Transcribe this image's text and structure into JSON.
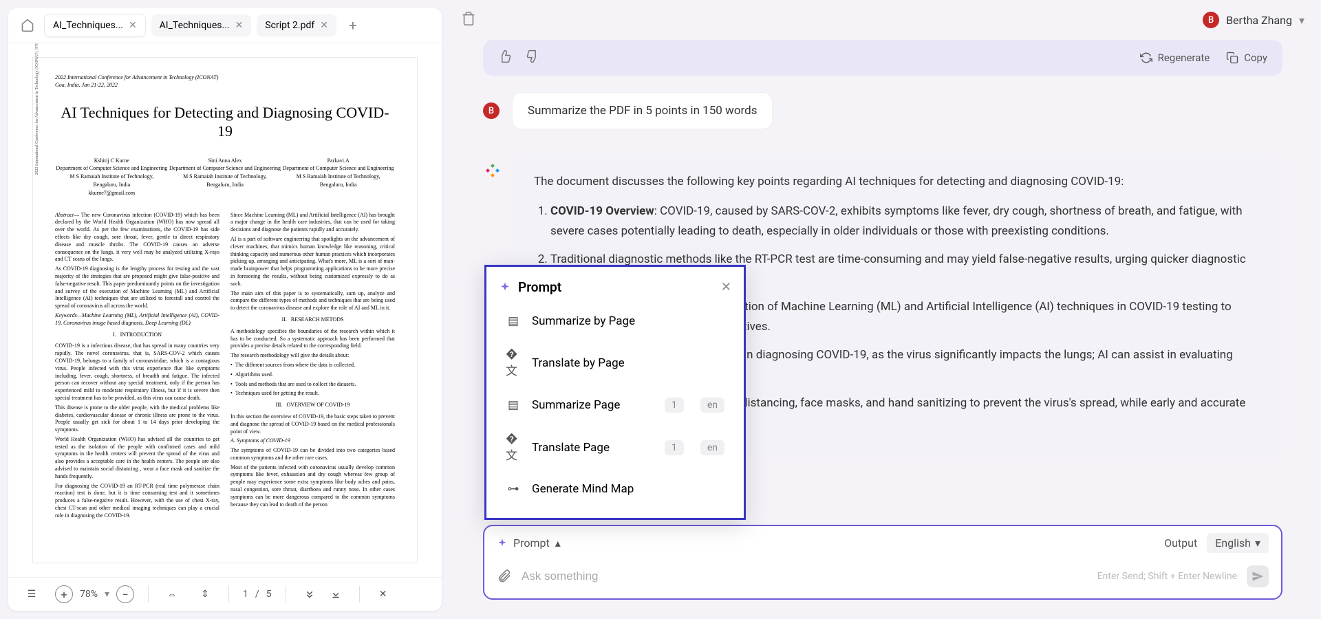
{
  "tabs": [
    {
      "label": "AI_Techniques...",
      "active": true
    },
    {
      "label": "AI_Techniques...",
      "active": false
    },
    {
      "label": "Script 2.pdf",
      "active": false
    }
  ],
  "doc": {
    "conference": "2022 International Conference for Advancement in Technology (ICONAT)\nGoa, India. Jan 21-22, 2022",
    "title": "AI Techniques for Detecting and Diagnosing COVID-19",
    "authors": [
      {
        "name": "Kshitij C Kurne",
        "dept": "Department of Computer Science and Engineering",
        "inst": "M S Ramaiah Institute of Technology,",
        "city": "Bengaluru, India",
        "email": "kkurne7@gmail.com"
      },
      {
        "name": "Sini Anna Alex",
        "dept": "Department of Computer Science and Engineering",
        "inst": "M S Ramaiah Institute of Technology,",
        "city": "Bengaluru, India",
        "email": ""
      },
      {
        "name": "Parkavi.A",
        "dept": "Department of Computer Science and Engineering",
        "inst": "M S Ramaiah Institute of Technology,",
        "city": "Bengaluru, India",
        "email": ""
      }
    ],
    "sidebar_text": "2022 International Conference for Advancement in Technology (ICONAT) | 978-1-6654-2577-3/22/$31.00 ©2022 IEEE | DOI: 10.1109/ICONAT53423.2022.9725935"
  },
  "toolbar": {
    "zoom": "78%",
    "page_current": "1",
    "page_total": "5"
  },
  "user": {
    "name": "Bertha Zhang",
    "initial": "B"
  },
  "actions": {
    "regenerate": "Regenerate",
    "copy": "Copy"
  },
  "user_message": "Summarize the PDF in 5 points in 150 words",
  "ai_response": {
    "intro": "The document discusses the following key points regarding AI techniques for detecting and diagnosing COVID-19:",
    "points": [
      {
        "title": "COVID-19 Overview",
        "body": ": COVID-19, caused by SARS-COV-2, exhibits symptoms like fever, dry cough, shortness of breath, and fatigue, with severe cases potentially leading to death, especially in older individuals or those with preexisting conditions."
      },
      {
        "title": "",
        "body": "Traditional diagnostic methods like the RT-PCR test are time-consuming and may yield false-negative results, urging quicker diagnostic approaches."
      },
      {
        "title": "",
        "body": "The research reviews the implementation of Machine Learning (ML) and Artificial Intelligence (AI) techniques in COVID-19 testing to reduce false positives and false negatives."
      },
      {
        "title": "",
        "body": "X-rays and CT-scans are critical tools in diagnosing COVID-19, as the virus significantly impacts the lungs; AI can assist in evaluating these images."
      },
      {
        "title": "",
        "body": "Emphasizes testing, isolation, social distancing, face masks, and hand sanitizing to prevent the virus's spread, while early and accurate diagnosis."
      }
    ]
  },
  "prompt_menu": {
    "title": "Prompt",
    "items": [
      {
        "label": "Summarize by Page",
        "icon": "doc"
      },
      {
        "label": "Translate by Page",
        "icon": "translate"
      },
      {
        "label": "Summarize Page",
        "icon": "doc",
        "page": "1",
        "lang": "en"
      },
      {
        "label": "Translate Page",
        "icon": "translate",
        "page": "1",
        "lang": "en"
      },
      {
        "label": "Generate Mind Map",
        "icon": "mindmap"
      }
    ]
  },
  "input": {
    "prompt_btn": "Prompt",
    "output_label": "Output",
    "language": "English",
    "placeholder": "Ask something",
    "hint": "Enter Send; Shift + Enter Newline"
  }
}
